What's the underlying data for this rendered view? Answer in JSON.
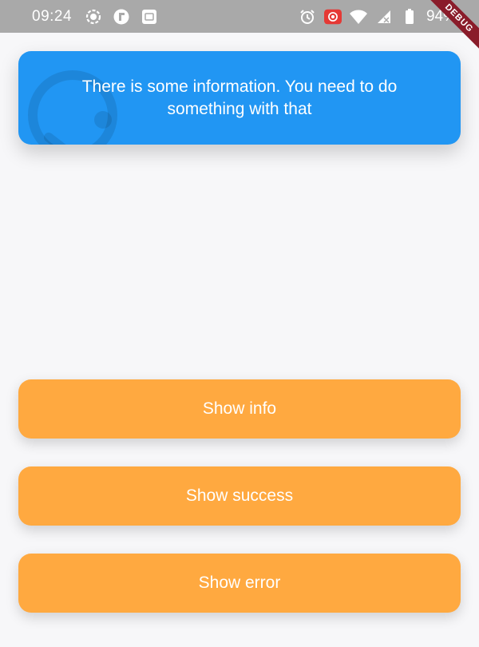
{
  "status_bar": {
    "time": "09:24",
    "battery": "94%",
    "icons_left": [
      "record-icon",
      "app-f-icon",
      "gallery-icon"
    ],
    "icons_right": [
      "alarm-icon",
      "screen-record-icon",
      "wifi-icon",
      "signal-icon",
      "battery-icon"
    ]
  },
  "debug_banner": {
    "label": "DEBUG"
  },
  "toast": {
    "message": "There is some information. You need to do something with that",
    "color": "#2196f3",
    "icon": "info-icon"
  },
  "buttons": {
    "info": "Show info",
    "success": "Show success",
    "error": "Show error",
    "color": "#ffa940"
  }
}
